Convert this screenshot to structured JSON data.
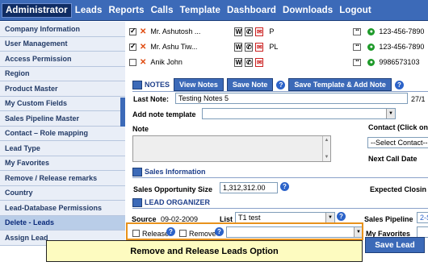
{
  "menu": [
    "Administrator",
    "Leads",
    "Reports",
    "Calls",
    "Template",
    "Dashboard",
    "Downloads",
    "Logout"
  ],
  "sidebar": [
    "Company Information",
    "User Management",
    "Access Permission",
    "Region",
    "Product Master",
    "My Custom Fields",
    "Sales Pipeline Master",
    "Contact – Role mapping",
    "Lead Type",
    "My Favorites",
    "Remove / Release remarks",
    "Country",
    "Lead-Database Permissions",
    "Delete - Leads",
    "Assign Lead"
  ],
  "contacts": [
    {
      "name": "Mr. Ashutosh ...",
      "tag": "P",
      "phone": "123-456-7890"
    },
    {
      "name": "Mr. Ashu Tiw...",
      "tag": "PL",
      "phone": "123-456-7890"
    },
    {
      "name": "Anik John",
      "tag": "",
      "phone": "9986573103"
    }
  ],
  "icons": {
    "w": "W",
    "phone": "✆",
    "doc": "✉"
  },
  "notes": {
    "title": "NOTES",
    "view": "View Notes",
    "save": "Save Note",
    "save_template": "Save Template & Add Note",
    "last_note_label": "Last Note:",
    "last_note_value": "Testing Notes 5",
    "last_note_date": "27/1",
    "add_template_label": "Add note template",
    "note_label": "Note",
    "contact_label": "Contact (Click on",
    "contact_select": "--Select Contact--",
    "next_call_label": "Next Call Date"
  },
  "sales": {
    "title": "Sales Information",
    "opp_label": "Sales Opportunity Size",
    "opp_value": "1,312,312.00",
    "expected_label": "Expected Closin"
  },
  "organizer": {
    "title": "LEAD ORGANIZER",
    "source_label": "Source",
    "source_value": "09-02-2009",
    "list_label": "List",
    "list_value": "T1 test",
    "pipeline_label": "Sales Pipeline",
    "pipeline_value": "2-S",
    "release_label": "Release",
    "remove_label": "Remove",
    "favorites_label": "My Favorites"
  },
  "save_lead": "Save Lead",
  "tip": "Remove and Release Leads Option",
  "colors": {
    "menu_bg": "#3c6ab8",
    "highlight": "#e8921c",
    "tip_bg": "#fdfbc0"
  }
}
